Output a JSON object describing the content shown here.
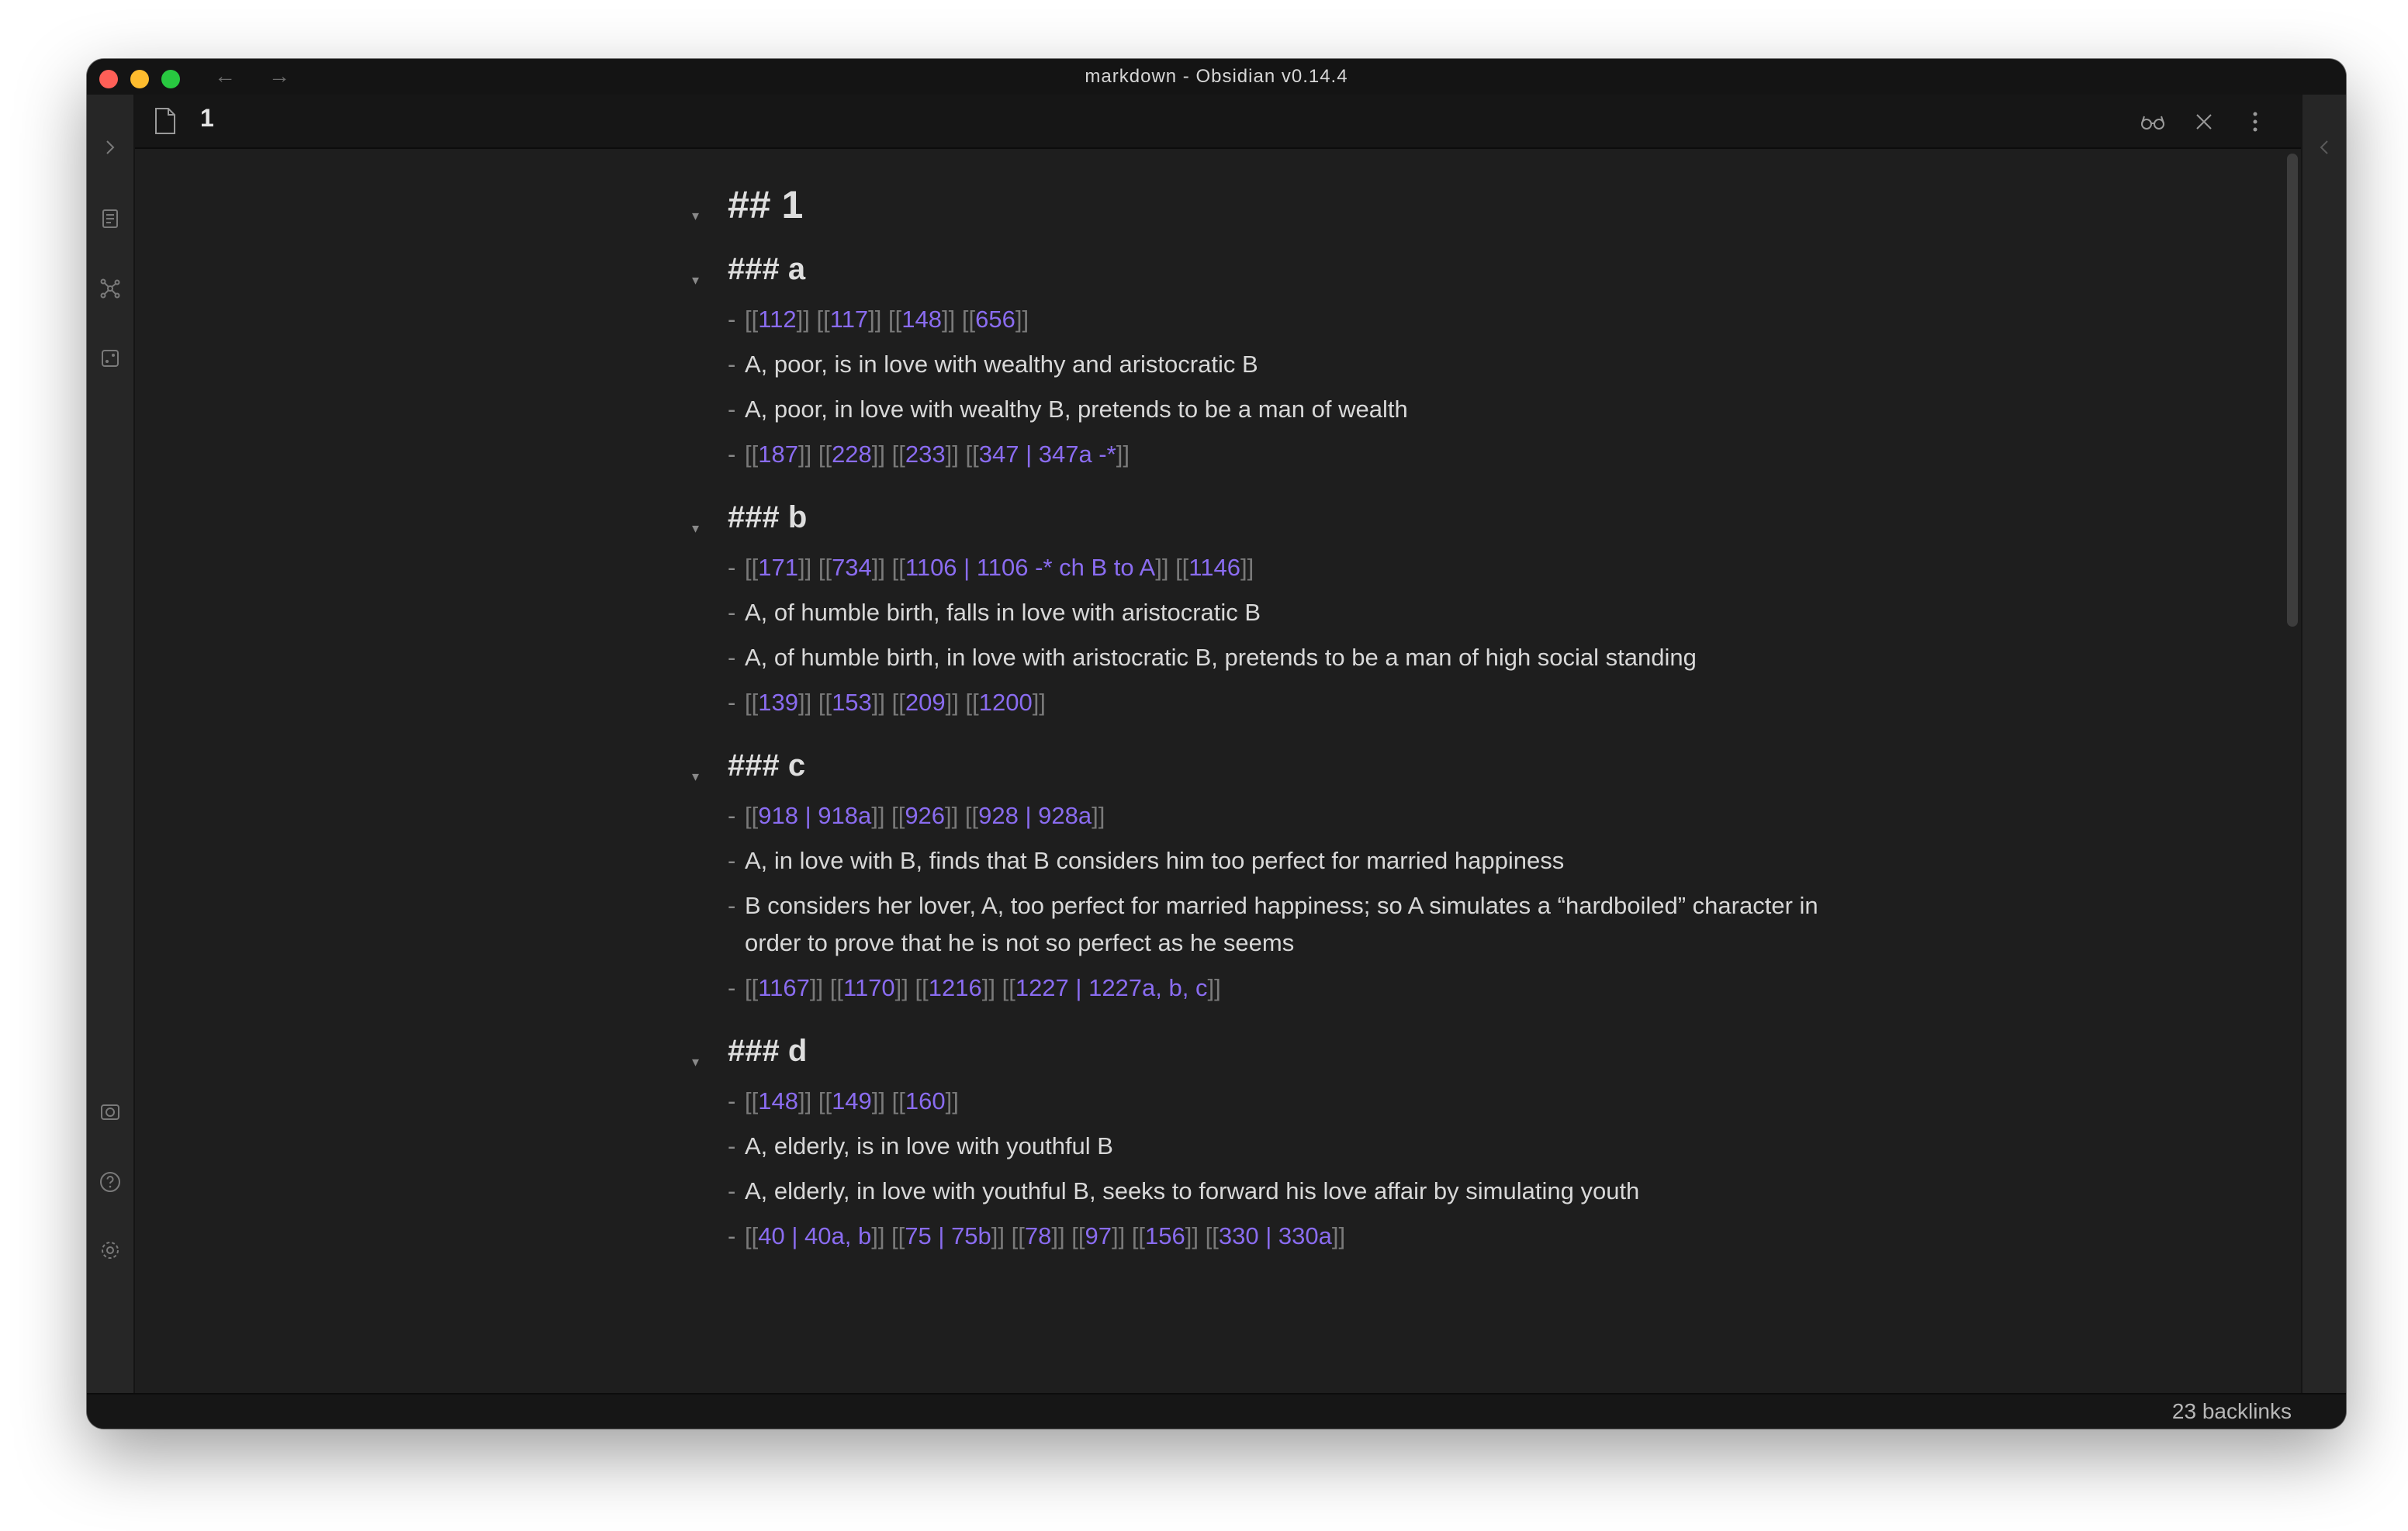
{
  "window": {
    "title": "markdown - Obsidian v0.14.4",
    "back_arrow": "←",
    "forward_arrow": "→"
  },
  "ribbon": {
    "top_icons": [
      "chevron-right-icon",
      "files-icon",
      "graph-view-icon",
      "random-note-icon"
    ],
    "bottom_icons": [
      "vault-icon",
      "help-icon",
      "settings-icon"
    ]
  },
  "tab": {
    "title": "1",
    "actions": [
      "reading-view-icon",
      "close-icon",
      "more-options-icon"
    ]
  },
  "note": {
    "h2": "## 1",
    "sections": [
      {
        "heading": "### a",
        "items": [
          {
            "type": "links",
            "links": [
              {
                "target": "112"
              },
              {
                "target": "117"
              },
              {
                "target": "148"
              },
              {
                "target": "656"
              }
            ]
          },
          {
            "type": "text",
            "text": "A, poor, is in love with wealthy and aristocratic B"
          },
          {
            "type": "text",
            "text": "A, poor, in love with wealthy B, pretends to be a man of wealth"
          },
          {
            "type": "links",
            "links": [
              {
                "target": "187"
              },
              {
                "target": "228"
              },
              {
                "target": "233"
              },
              {
                "target": "347",
                "alias": "347a -*"
              }
            ]
          }
        ]
      },
      {
        "heading": "### b",
        "items": [
          {
            "type": "links",
            "links": [
              {
                "target": "171"
              },
              {
                "target": "734"
              },
              {
                "target": "1106",
                "alias": "1106 -* ch B to A"
              },
              {
                "target": "1146"
              }
            ]
          },
          {
            "type": "text",
            "text": "A, of humble birth, falls in love with aristocratic B"
          },
          {
            "type": "text",
            "text": "A, of humble birth, in love with aristocratic B, pretends to be a man of high social standing"
          },
          {
            "type": "links",
            "links": [
              {
                "target": "139"
              },
              {
                "target": "153"
              },
              {
                "target": "209"
              },
              {
                "target": "1200"
              }
            ]
          }
        ]
      },
      {
        "heading": "### c",
        "items": [
          {
            "type": "links",
            "links": [
              {
                "target": "918",
                "alias": "918a"
              },
              {
                "target": "926"
              },
              {
                "target": "928",
                "alias": "928a"
              }
            ]
          },
          {
            "type": "text",
            "text": "A, in love with B, finds that B considers him too perfect for married happiness"
          },
          {
            "type": "text",
            "text": "B considers her lover, A, too perfect for married happiness; so A simulates a “hardboiled” character in order to prove that he is not so perfect as he seems"
          },
          {
            "type": "links",
            "links": [
              {
                "target": "1167"
              },
              {
                "target": "1170"
              },
              {
                "target": "1216"
              },
              {
                "target": "1227",
                "alias": "1227a, b, c"
              }
            ]
          }
        ]
      },
      {
        "heading": "### d",
        "items": [
          {
            "type": "links",
            "links": [
              {
                "target": "148"
              },
              {
                "target": "149"
              },
              {
                "target": "160"
              }
            ]
          },
          {
            "type": "text",
            "text": "A, elderly, is in love with youthful B"
          },
          {
            "type": "text",
            "text": "A, elderly, in love with youthful B, seeks to forward his love affair by simulating youth"
          },
          {
            "type": "links",
            "links": [
              {
                "target": "40",
                "alias": "40a, b"
              },
              {
                "target": "75",
                "alias": "75b"
              },
              {
                "target": "78"
              },
              {
                "target": "97"
              },
              {
                "target": "156"
              },
              {
                "target": "330",
                "alias": "330a"
              }
            ]
          }
        ]
      }
    ]
  },
  "statusbar": {
    "backlinks": "23 backlinks"
  },
  "colors": {
    "background": "#1e1e1e",
    "link": "#8a6cf0",
    "text": "#d8d8d8",
    "muted": "#7a7a7a"
  }
}
